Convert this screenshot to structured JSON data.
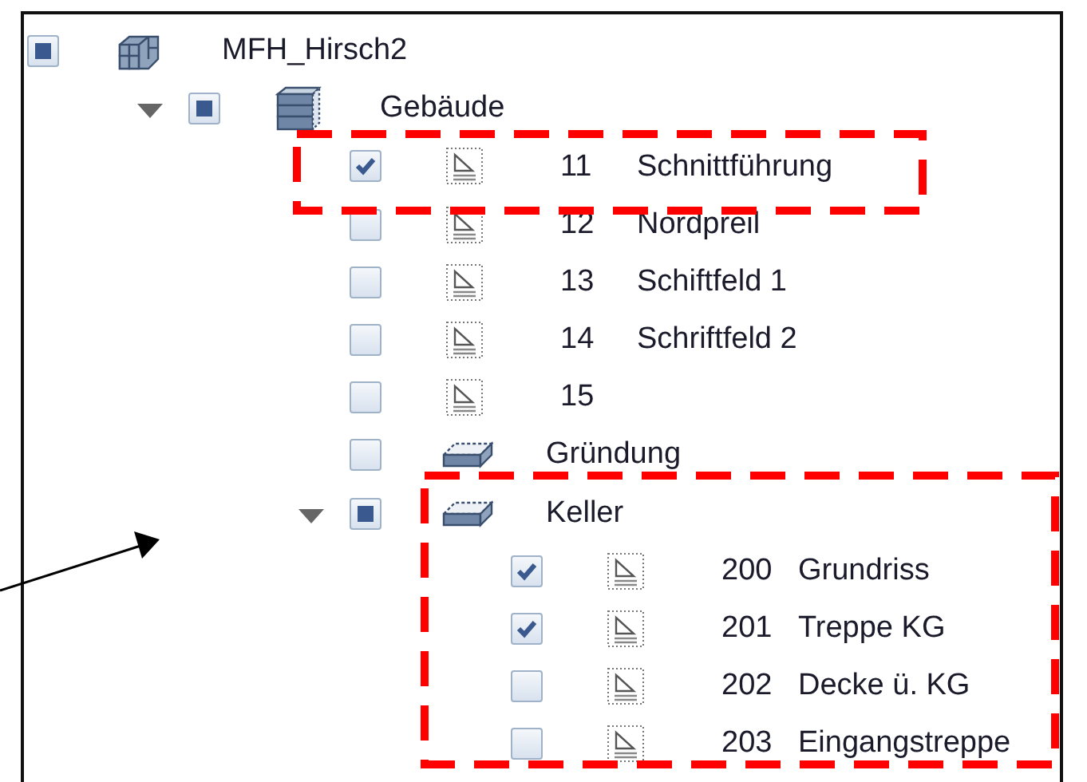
{
  "tree": [
    {
      "kind": "project",
      "label": "MFH_Hirsch2",
      "checked": false,
      "mixed": true,
      "children": [
        {
          "kind": "building",
          "label": "Gebäude",
          "checked": false,
          "mixed": true,
          "expanded": true,
          "children": [
            {
              "kind": "plan",
              "number": "11",
              "label": "Schnittführung",
              "checked": true,
              "mixed": false
            },
            {
              "kind": "plan",
              "number": "12",
              "label": "Nordpreil",
              "checked": false,
              "mixed": false
            },
            {
              "kind": "plan",
              "number": "13",
              "label": "Schiftfeld 1",
              "checked": false,
              "mixed": false
            },
            {
              "kind": "plan",
              "number": "14",
              "label": "Schriftfeld 2",
              "checked": false,
              "mixed": false
            },
            {
              "kind": "plan",
              "number": "15",
              "checked": false,
              "mixed": false
            },
            {
              "kind": "floor",
              "label": "Gründung",
              "checked": false,
              "mixed": false
            },
            {
              "kind": "floor",
              "label": "Keller",
              "checked": false,
              "mixed": true,
              "expanded": true,
              "children": [
                {
                  "kind": "plan",
                  "number": "200",
                  "label": "Grundriss",
                  "checked": true,
                  "mixed": false
                },
                {
                  "kind": "plan",
                  "number": "201",
                  "label": "Treppe KG",
                  "checked": true,
                  "mixed": false
                },
                {
                  "kind": "plan",
                  "number": "202",
                  "label": "Decke ü. KG",
                  "checked": false,
                  "mixed": false
                },
                {
                  "kind": "plan",
                  "number": "203",
                  "label": "Eingangstreppe",
                  "checked": false,
                  "mixed": false
                }
              ]
            }
          ]
        }
      ]
    }
  ]
}
